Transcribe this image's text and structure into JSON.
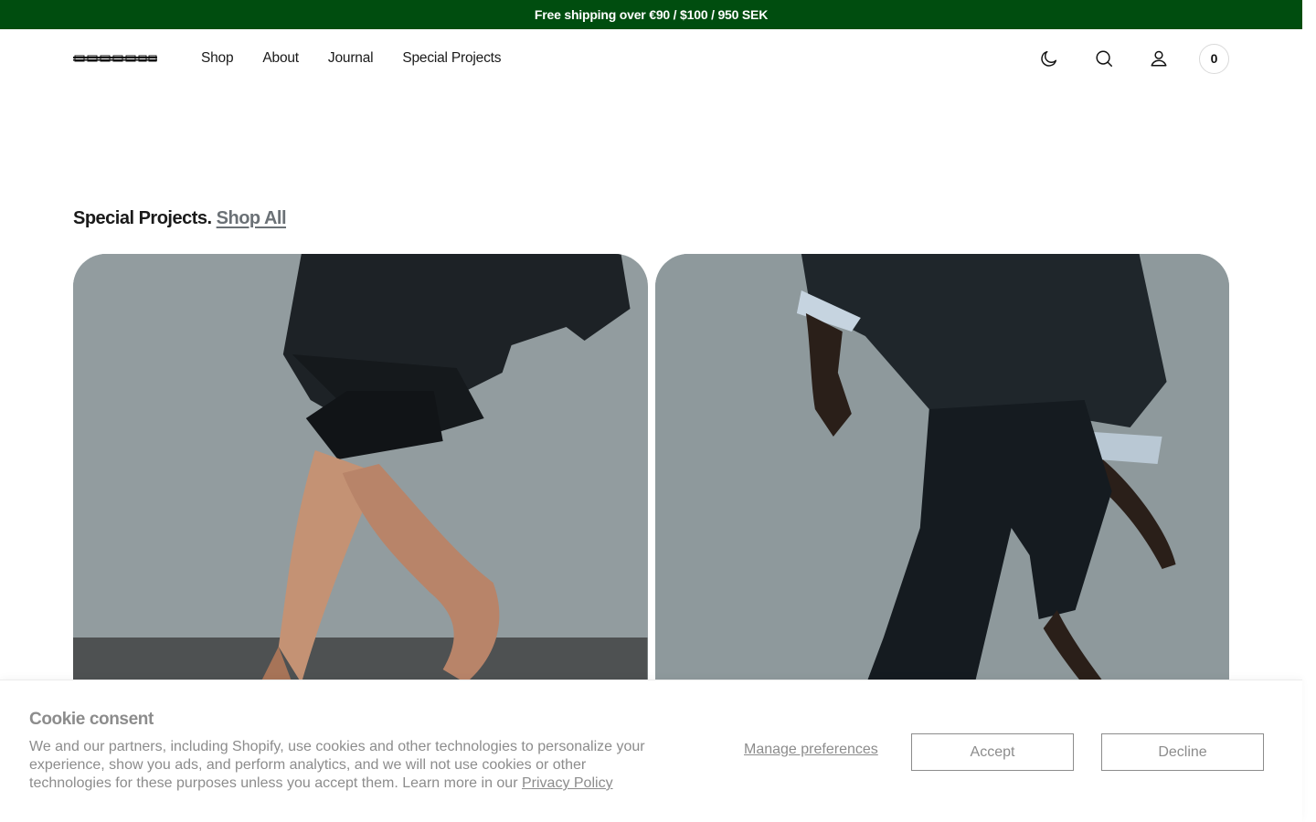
{
  "announcement": {
    "text": "Free shipping over €90 / $100 / 950 SEK"
  },
  "header": {
    "logo_text": "SOCKSSS",
    "nav": [
      "Shop",
      "About",
      "Journal",
      "Special Projects"
    ],
    "icons": [
      "moon-icon",
      "search-icon",
      "account-icon"
    ],
    "cart_count": "0"
  },
  "section": {
    "title": "Special Projects.",
    "link": "Shop All"
  },
  "cookie": {
    "title": "Cookie consent",
    "text": "We and our partners, including Shopify, use cookies and other technologies to personalize your experience, show you ads, and perform analytics, and we will not use cookies or other technologies for these purposes unless you accept them. Learn more in our",
    "privacy_link": "Privacy Policy",
    "manage": "Manage preferences",
    "accept": "Accept",
    "decline": "Decline"
  },
  "colors": {
    "announcement_bg": "#004d0f",
    "muted": "#8c8c8c"
  }
}
